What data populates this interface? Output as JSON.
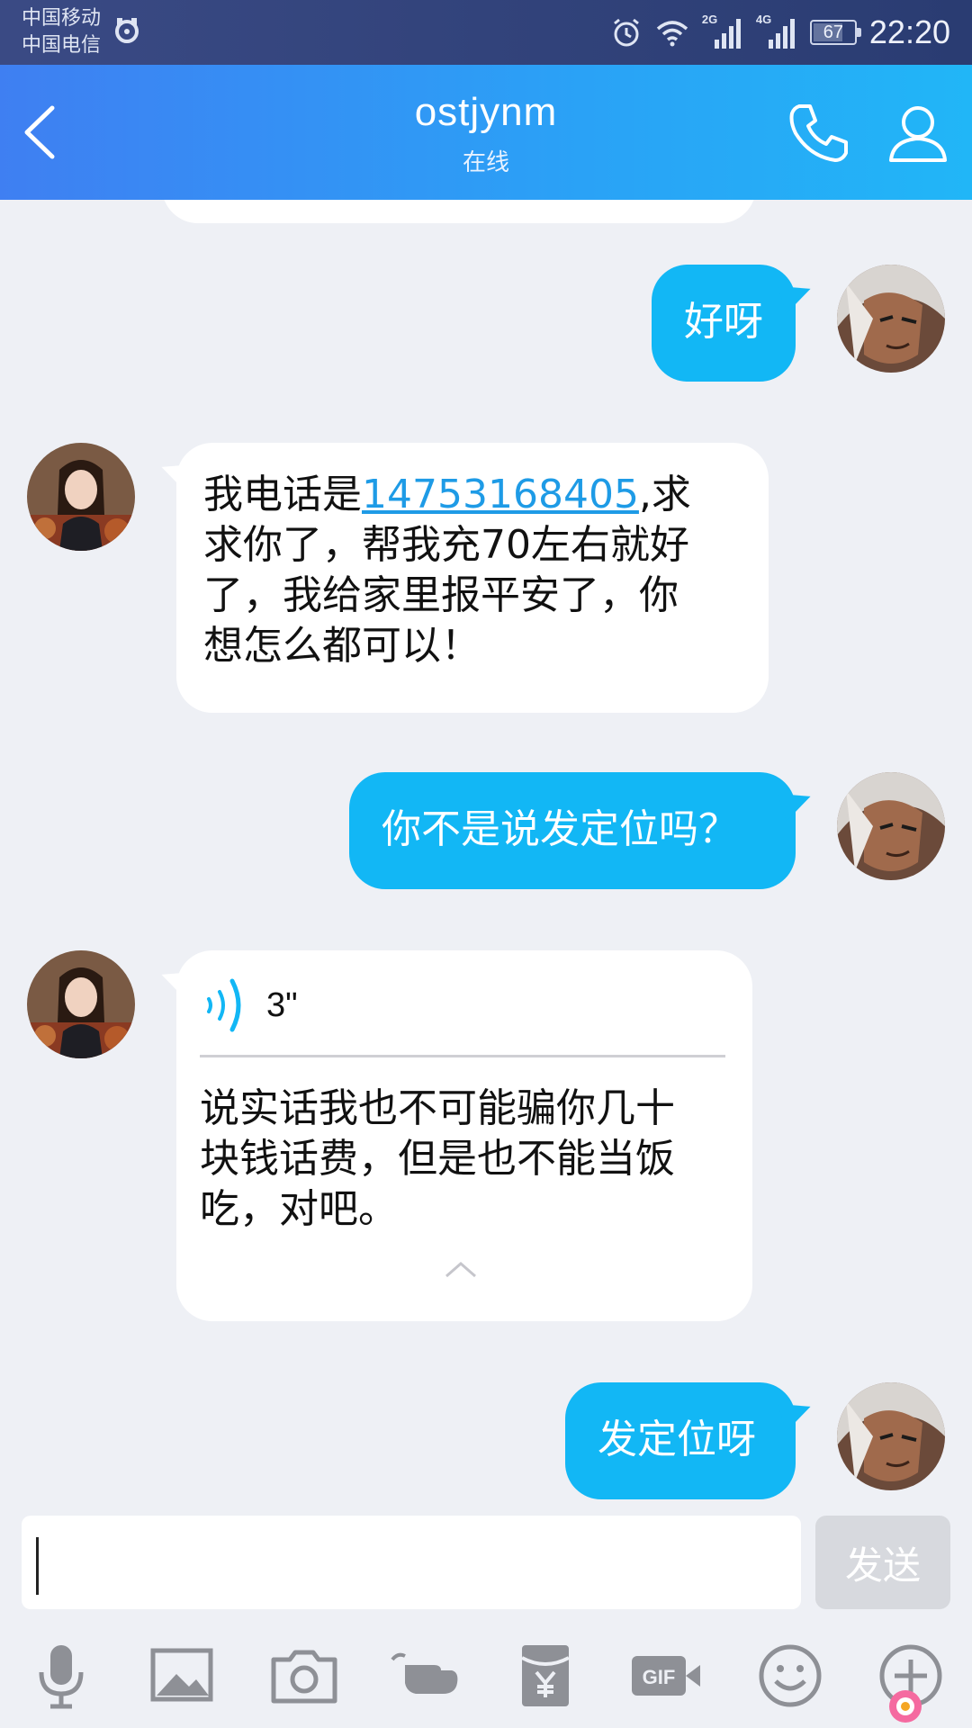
{
  "status_bar": {
    "carrier_1": "中国移动",
    "carrier_2": "中国电信",
    "network_a": "2G",
    "network_b": "4G",
    "battery_level": "67",
    "time": "22:20"
  },
  "header": {
    "contact_name": "ostjynm",
    "contact_status": "在线"
  },
  "messages": [
    {
      "from": "me",
      "type": "text",
      "text": "好呀"
    },
    {
      "from": "contact",
      "type": "text",
      "line_1_prefix": "我电话是",
      "phone": "14753168405",
      "line_1_suffix": ",求",
      "line_2": "求你了，帮我充70左右就好",
      "line_3": "了，我给家里报平安了，你",
      "line_4": "想怎么都可以！"
    },
    {
      "from": "me",
      "type": "text",
      "text": "你不是说发定位吗？"
    },
    {
      "from": "contact",
      "type": "voice",
      "duration": "3\"",
      "transcript_line_1": "说实话我也不可能骗你几十",
      "transcript_line_2": "块钱话费，但是也不能当饭",
      "transcript_line_3": "吃，对吧。"
    },
    {
      "from": "me",
      "type": "text",
      "text": "发定位呀"
    }
  ],
  "composer": {
    "input_value": "",
    "send_label": "发送"
  },
  "toolbar": {
    "items": [
      "microphone-icon",
      "image-icon",
      "camera-icon",
      "poke-hand-icon",
      "red-packet-icon",
      "gif-icon",
      "emoji-icon",
      "plus-icon"
    ]
  },
  "colors": {
    "header_start": "#3f7ff2",
    "header_end": "#21b6f7",
    "outgoing_bubble": "#12b7f5",
    "incoming_bubble": "#ffffff",
    "chat_background": "#eef0f5",
    "link": "#1e9be6",
    "icon_gray": "#8e9096"
  }
}
